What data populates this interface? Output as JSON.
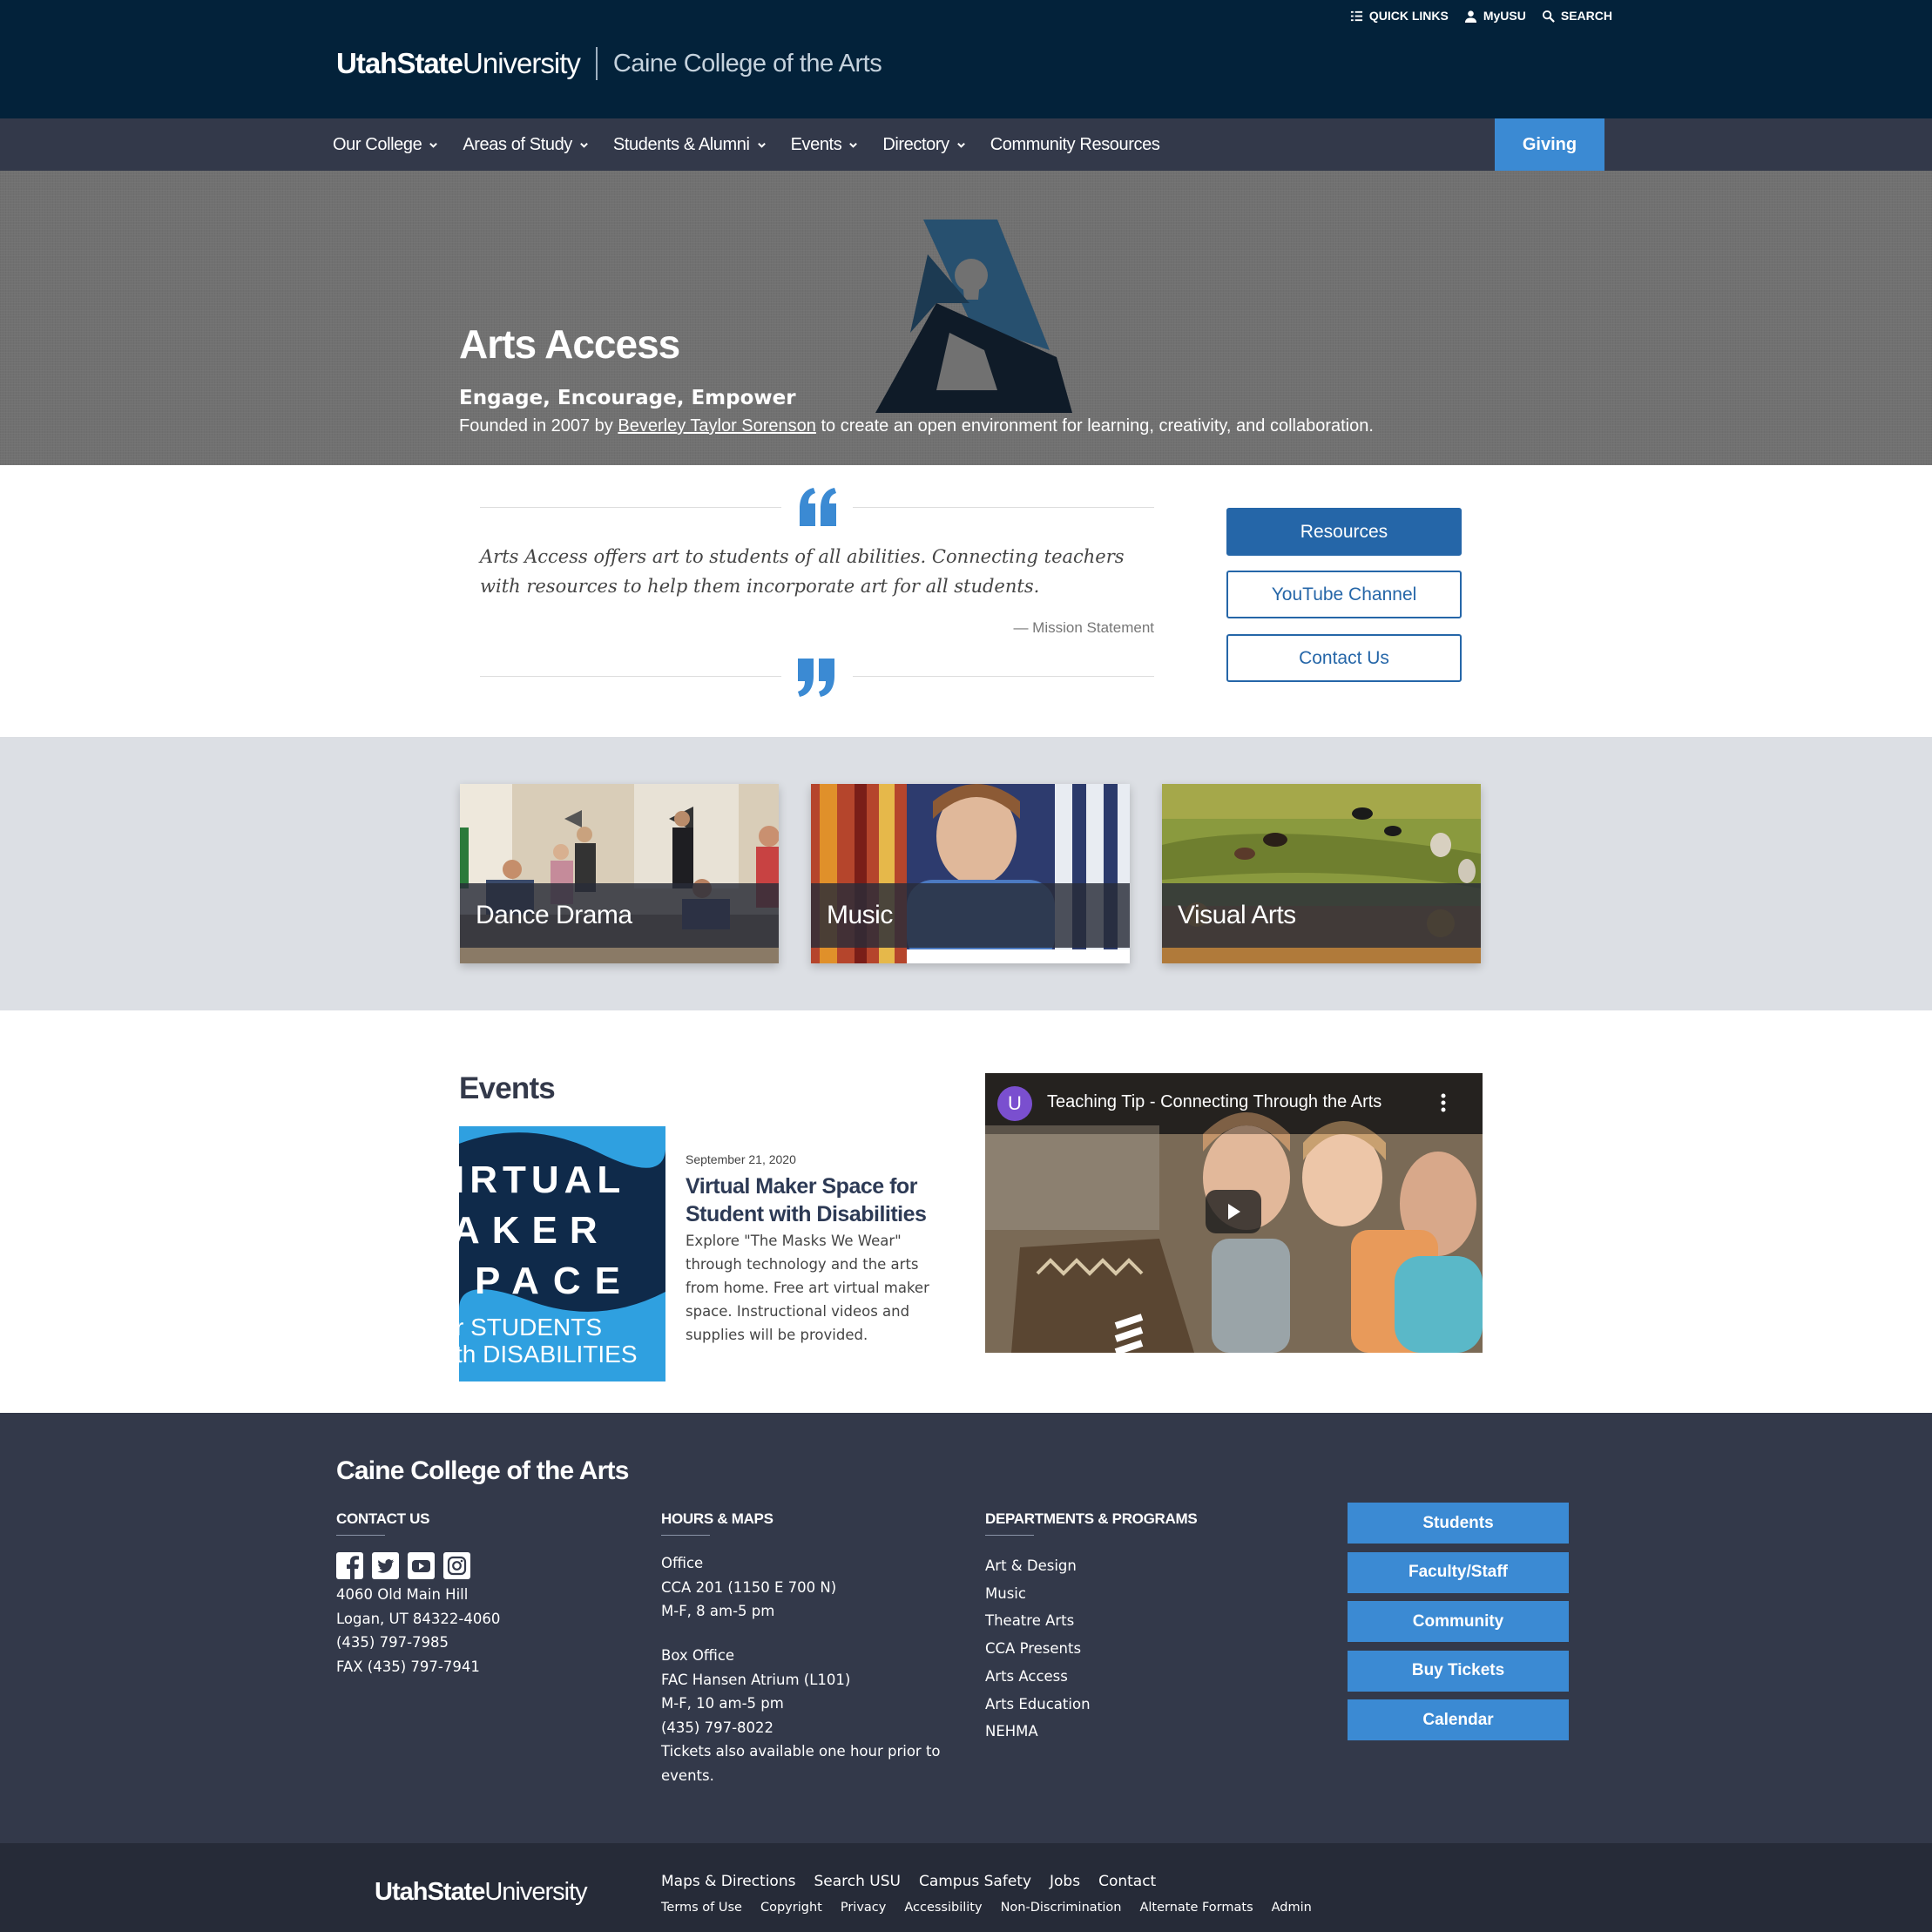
{
  "utility": {
    "quick_links": "QUICK LINKS",
    "myusu": "MyUSU",
    "search": "SEARCH"
  },
  "brand": {
    "usu_bold": "UtahState",
    "usu_light": "University",
    "college": "Caine College of the Arts"
  },
  "nav": {
    "items": [
      {
        "label": "Our College",
        "dropdown": true
      },
      {
        "label": "Areas of Study",
        "dropdown": true
      },
      {
        "label": "Students & Alumni",
        "dropdown": true
      },
      {
        "label": "Events",
        "dropdown": true
      },
      {
        "label": "Directory",
        "dropdown": true
      },
      {
        "label": "Community Resources",
        "dropdown": false
      }
    ],
    "giving": "Giving"
  },
  "hero": {
    "title": "Arts Access",
    "subtitle": "Engage, Encourage, Empower",
    "desc_before": "Founded in 2007 by ",
    "desc_link": "Beverley Taylor Sorenson",
    "desc_after": " to create an open environment for learning, creativity, and collaboration."
  },
  "quote": {
    "text": "Arts Access offers art to students of all abilities. Connecting teachers with resources to help them incorporate art for all students.",
    "cite": "— Mission Statement"
  },
  "side_buttons": [
    "Resources",
    "YouTube Channel",
    "Contact Us"
  ],
  "areas": [
    {
      "label": "Dance Drama"
    },
    {
      "label": "Music"
    },
    {
      "label": "Visual Arts"
    }
  ],
  "events": {
    "heading": "Events",
    "date": "September 21, 2020",
    "title": "Virtual Maker Space for Student with Disabilities",
    "desc": "Explore \"The Masks We Wear\" through technology and the arts from home. Free art virtual maker space. Instructional videos and supplies will be provided.",
    "image_text": [
      "IRTUAL",
      "AKER",
      "PACE",
      "r STUDENTS",
      "th DISABILITIES"
    ]
  },
  "video": {
    "avatar": "U",
    "title": "Teaching Tip - Connecting Through the Arts"
  },
  "footer": {
    "title": "Caine College of the Arts",
    "contact_head": "CONTACT US",
    "contact_lines": [
      "4060 Old Main Hill",
      "Logan, UT 84322-4060",
      "(435) 797-7985",
      "FAX (435) 797-7941"
    ],
    "hours_head": "HOURS & MAPS",
    "office_lines": [
      "Office",
      "CCA 201 (1150 E 700 N)",
      "M-F, 8 am-5 pm"
    ],
    "box_lines": [
      "Box Office",
      "FAC Hansen Atrium (L101)",
      "M-F, 10 am-5 pm",
      "(435) 797-8022",
      "Tickets also available one hour prior to",
      "events."
    ],
    "dept_head": "DEPARTMENTS & PROGRAMS",
    "depts": [
      "Art & Design",
      "Music",
      "Theatre Arts",
      "CCA Presents",
      "Arts Access",
      "Arts Education",
      "NEHMA"
    ],
    "buttons": [
      "Students",
      "Faculty/Staff",
      "Community",
      "Buy Tickets",
      "Calendar"
    ]
  },
  "subfooter": {
    "usu_bold": "UtahState",
    "usu_light": "University",
    "links1": [
      "Maps & Directions",
      "Search USU",
      "Campus Safety",
      "Jobs",
      "Contact"
    ],
    "links2": [
      "Terms of Use",
      "Copyright",
      "Privacy",
      "Accessibility",
      "Non-Discrimination",
      "Alternate Formats",
      "Admin"
    ]
  },
  "colors": {
    "header": "#03223a",
    "nav": "#33394a",
    "accent": "#3b8ad3",
    "button_blue": "#2566a8",
    "footer": "#33394a"
  }
}
